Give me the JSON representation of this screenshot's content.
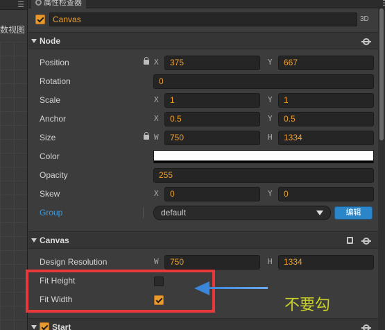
{
  "left_panel": {
    "title": "数视图"
  },
  "inspector_tab": {
    "title": "属性检查器"
  },
  "node": {
    "enabled": true,
    "name": "Canvas",
    "tag_3d": "3D"
  },
  "sections": {
    "node": {
      "title": "Node"
    },
    "canvas": {
      "title": "Canvas"
    },
    "start": {
      "title": "Start",
      "enabled": true
    }
  },
  "properties": {
    "position": {
      "label": "Position",
      "x_axis": "X",
      "x": "375",
      "y_axis": "Y",
      "y": "667"
    },
    "rotation": {
      "label": "Rotation",
      "value": "0"
    },
    "scale": {
      "label": "Scale",
      "x_axis": "X",
      "x": "1",
      "y_axis": "Y",
      "y": "1"
    },
    "anchor": {
      "label": "Anchor",
      "x_axis": "X",
      "x": "0.5",
      "y_axis": "Y",
      "y": "0.5"
    },
    "size": {
      "label": "Size",
      "w_axis": "W",
      "w": "750",
      "h_axis": "H",
      "h": "1334"
    },
    "color": {
      "label": "Color",
      "value": "#ffffff"
    },
    "opacity": {
      "label": "Opacity",
      "value": "255"
    },
    "skew": {
      "label": "Skew",
      "x_axis": "X",
      "x": "0",
      "y_axis": "Y",
      "y": "0"
    },
    "group": {
      "label": "Group",
      "value": "default",
      "edit_label": "编辑"
    }
  },
  "canvas": {
    "design_resolution": {
      "label": "Design Resolution",
      "w_axis": "W",
      "w": "750",
      "h_axis": "H",
      "h": "1334"
    },
    "fit_height": {
      "label": "Fit Height",
      "checked": false
    },
    "fit_width": {
      "label": "Fit Width",
      "checked": true
    }
  },
  "annotation": {
    "text": "不要勾",
    "color": "#c9d02a",
    "highlight_color": "#e8383b",
    "arrow_color": "#3a86d8"
  },
  "colors": {
    "accent": "#e89a2f",
    "value_text": "#f0a030",
    "link": "#3c9bda",
    "button": "#2a86c8"
  }
}
